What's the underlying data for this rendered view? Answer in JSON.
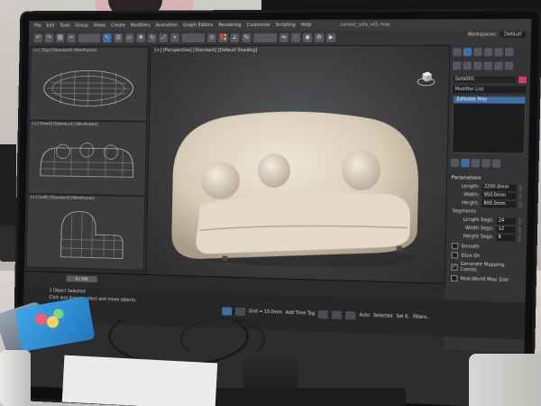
{
  "menu": [
    "File",
    "Edit",
    "Tools",
    "Group",
    "Views",
    "Create",
    "Modifiers",
    "Animation",
    "Graph Editors",
    "Rendering",
    "Customize",
    "Scripting",
    "Help"
  ],
  "file_name": "curved_sofa_v01.max",
  "workspace": {
    "label": "Workspaces:",
    "value": "Default"
  },
  "viewports": {
    "top": "[+] [Top] [Standard] [Wireframe]",
    "front": "[+] [Front] [Standard] [Wireframe]",
    "left": "[+] [Left] [Standard] [Wireframe]",
    "perspective": "[+] [Perspective] [Standard] [Default Shading]"
  },
  "command_panel": {
    "object_name": "Sofa001",
    "modifier_list": "Modifier List",
    "stack_item": "Editable Poly",
    "parameters_title": "Parameters",
    "params": [
      {
        "label": "Length:",
        "value": "2200.0mm"
      },
      {
        "label": "Width:",
        "value": "950.0mm"
      },
      {
        "label": "Height:",
        "value": "800.0mm"
      },
      {
        "label": "Segments",
        "value": ""
      },
      {
        "label": "Length Segs:",
        "value": "24"
      },
      {
        "label": "Width Segs:",
        "value": "12"
      },
      {
        "label": "Height Segs:",
        "value": "8"
      },
      {
        "label": "Smooth",
        "value": ""
      }
    ],
    "checkboxes": [
      {
        "label": "Slice On",
        "checked": false
      },
      {
        "label": "Generate Mapping Coords.",
        "checked": true
      },
      {
        "label": "Real-World Map Size",
        "checked": false
      }
    ]
  },
  "timeline": {
    "slider": "0 / 100"
  },
  "status": {
    "line1": "1 Object Selected",
    "line2": "Click and drag to select and move objects"
  },
  "bottom": {
    "grid": "Grid = 10.0mm",
    "add_time_tag": "Add Time Tag",
    "auto": "Auto",
    "selected": "Selected",
    "set_key": "Set K.",
    "filters": "Filters..."
  },
  "colors": {
    "accent": "#3d6fa8",
    "object_color": "#d9386a",
    "sofa_fabric": "#d8cbb8"
  }
}
